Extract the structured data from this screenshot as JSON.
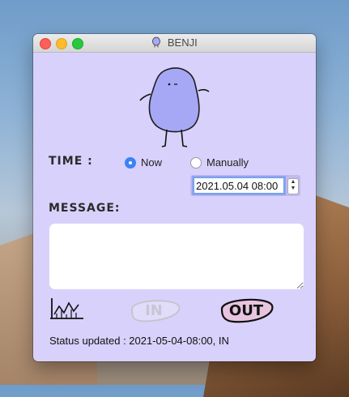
{
  "window": {
    "title": "BENJI"
  },
  "time": {
    "label": "TIME :",
    "options": [
      "Now",
      "Manually"
    ],
    "selected": "Now",
    "manual_value": "2021.05.04 08:00"
  },
  "message": {
    "label": "MESSAGE:",
    "value": ""
  },
  "actions": {
    "in_label": "IN",
    "out_label": "OUT"
  },
  "status": {
    "text": "Status updated : 2021-05-04-08:00, IN"
  },
  "colors": {
    "window_bg": "#d8d1fb",
    "mascot": "#a6a8f6",
    "in_disabled": "#e2dcfb",
    "out_fill": "#e7c5df"
  },
  "icons": {
    "stats": "chart-icon",
    "app": "benji-icon"
  }
}
